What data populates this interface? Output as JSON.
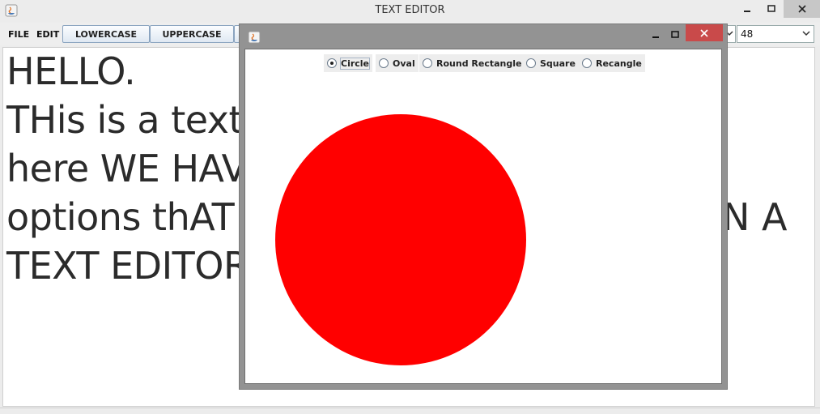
{
  "window": {
    "title": "TEXT EDITOR"
  },
  "menu": {
    "file": "FILE",
    "edit": "EDIT"
  },
  "toolbar": {
    "lowercase_label": "LOWERCASE",
    "uppercase_label": "UPPERCASE",
    "font_size": "48"
  },
  "document": {
    "lines": [
      "HELLO.",
      "THis is a text e",
      "here WE HAV",
      "options thAT",
      "TEXT EDITOR."
    ],
    "visible_tail": "N A"
  },
  "dialog": {
    "options": [
      {
        "label": "Circle",
        "checked": true
      },
      {
        "label": "Oval",
        "checked": false
      },
      {
        "label": "Round Rectangle",
        "checked": false
      },
      {
        "label": "Square",
        "checked": false
      },
      {
        "label": "Recangle",
        "checked": false
      }
    ],
    "shape": {
      "type": "circle",
      "color": "#ff0000"
    }
  },
  "colors": {
    "close_button": "#c94a4a",
    "accent_button_border": "#8aa4c0"
  }
}
